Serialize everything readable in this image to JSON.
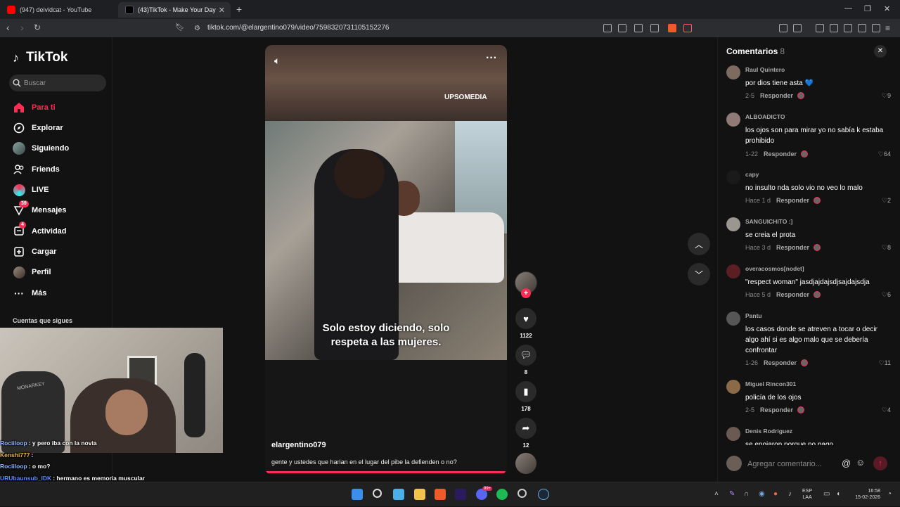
{
  "browser": {
    "tabs": [
      {
        "label": "(947) deividcat - YouTube"
      },
      {
        "label": "(43)TikTok - Make Your Day"
      }
    ],
    "url": "tiktok.com/@elargentino079/video/7598320731105152276",
    "ext_badge": "1"
  },
  "sidebar": {
    "logo": "TikTok",
    "search_placeholder": "Buscar",
    "items": [
      {
        "label": "Para ti",
        "icon": "home-icon"
      },
      {
        "label": "Explorar",
        "icon": "compass-icon"
      },
      {
        "label": "Siguiendo",
        "icon": "following-avatar-icon"
      },
      {
        "label": "Friends",
        "icon": "friends-icon"
      },
      {
        "label": "LIVE",
        "icon": "live-icon"
      },
      {
        "label": "Mensajes",
        "icon": "messages-icon",
        "badge": "39"
      },
      {
        "label": "Actividad",
        "icon": "activity-icon",
        "badge": "4"
      },
      {
        "label": "Cargar",
        "icon": "upload-icon"
      },
      {
        "label": "Perfil",
        "icon": "profile-icon"
      },
      {
        "label": "Más",
        "icon": "more-icon"
      }
    ],
    "following_title": "Cuentas que sigues"
  },
  "webcam": {
    "chair_logo": "MONARKEY",
    "chat": [
      {
        "user": "Rociiloop",
        "msg": ": y pero iba con la novia",
        "color": "#8fb7ff"
      },
      {
        "user": "Kenshi777",
        "msg": ":",
        "color": "#e3b34c"
      },
      {
        "user": "Rociiloop",
        "msg": ": o mo?",
        "color": "#8fb7ff"
      },
      {
        "user": "URUbaunsub_IDK",
        "msg": ": hermano es memoria muscular",
        "color": "#5a8cff"
      },
      {
        "user": "Enz0_1",
        "msg": ": y que tiene",
        "color": "#4fe07a"
      },
      {
        "user": "bruneit01",
        "msg": ": nelson vas a contar cuando caiste preso",
        "color": "#ffffff"
      }
    ]
  },
  "video": {
    "watermark": "UPSOMEDIA",
    "caption_line1": "Solo estoy diciendo, solo",
    "caption_line2": "respeta a las mujeres.",
    "author": "elargentino079",
    "description": "gente y ustedes que harian en el lugar del pibe la defienden o no?",
    "progress": 0.99,
    "likes": "1122",
    "comments": "8",
    "saves": "178",
    "shares": "12"
  },
  "comments": {
    "title": "Comentarios",
    "count": "8",
    "input_placeholder": "Agregar comentario...",
    "reply_label": "Responder",
    "items": [
      {
        "name": "Raul Quintero",
        "text": "por dios tiene asta 💙",
        "date": "2-5",
        "likes": "9"
      },
      {
        "name": "ALBOADICTO",
        "text": "los ojos son para mirar yo no sabía k estaba prohibido",
        "date": "1-22",
        "likes": "64"
      },
      {
        "name": "capy",
        "text": "no insulto nda solo vio no veo lo malo",
        "date": "Hace 1 d",
        "likes": "2"
      },
      {
        "name": "SANGUICHITO :]",
        "text": "se creia el prota",
        "date": "Hace 3 d",
        "likes": "8"
      },
      {
        "name": "overacosmos[nodet]",
        "text": "\"respect woman\" jasdjajdajsdjsajdajsdja",
        "date": "Hace 5 d",
        "likes": "6"
      },
      {
        "name": "Pantu",
        "text": "los casos donde se atreven a tocar o decir algo ahí si es algo malo que se debería confrontar",
        "date": "1-26",
        "likes": "11"
      },
      {
        "name": "Miguel Rincon301",
        "text": "policía de los ojos",
        "date": "2-5",
        "likes": "4"
      },
      {
        "name": "Denis Rodriguez",
        "text": "se enojaron porque no pago",
        "date": "",
        "likes": ""
      }
    ]
  },
  "taskbar": {
    "lang_top": "ESP",
    "lang_bottom": "LAA",
    "time": "16:58",
    "date": "15-02-2026",
    "discord_badge": "99+"
  }
}
